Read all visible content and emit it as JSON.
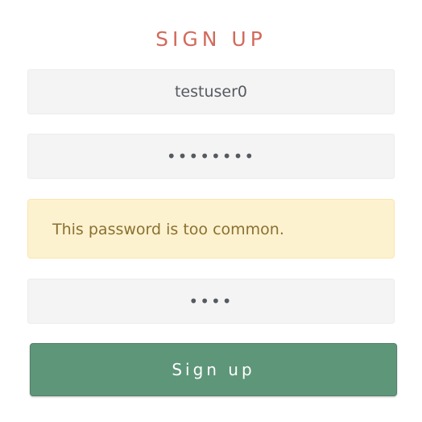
{
  "form": {
    "title": "SIGN UP",
    "username_value": "testuser0",
    "password_value": "••••••••",
    "alert_text": "This password is too common.",
    "password_confirm_value": "••••",
    "submit_label": "Sign up"
  },
  "colors": {
    "title": "#d26a5c",
    "field_background": "#f4f4f4",
    "alert_background": "#fdf2cf",
    "alert_text": "#8a7032",
    "button_background": "#5e9679"
  }
}
